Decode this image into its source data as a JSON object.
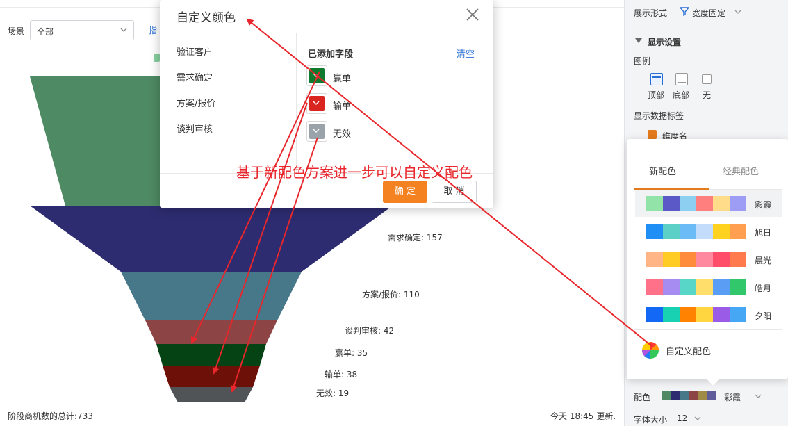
{
  "main": {
    "scene_label": "场景",
    "scene_value": "全部",
    "metric_link": "指",
    "footer_total": "阶段商机数的总计:733",
    "footer_time": "今天 18:45 更新."
  },
  "chart_data": {
    "type": "funnel",
    "stages": [
      {
        "name": "验证客户",
        "value": null,
        "color": "#4e8a63",
        "label": ""
      },
      {
        "name": "需求确定",
        "value": 157,
        "color": "#2d2c70",
        "label": "需求确定: 157"
      },
      {
        "name": "方案/报价",
        "value": 110,
        "color": "#47788a",
        "label": "方案/报价: 110"
      },
      {
        "name": "谈判审核",
        "value": 42,
        "color": "#8c4444",
        "label": "谈判审核: 42"
      },
      {
        "name": "赢单",
        "value": 35,
        "color": "#054314",
        "label": "赢单: 35"
      },
      {
        "name": "输单",
        "value": 38,
        "color": "#6d1007",
        "label": "输单: 38"
      },
      {
        "name": "无效",
        "value": 19,
        "color": "#515456",
        "label": "无效: 19"
      }
    ],
    "total": 733
  },
  "panel": {
    "display_form_label": "展示形式",
    "width_mode": "宽度固定",
    "display_settings": "显示设置",
    "legend_label": "图例",
    "legend_options": [
      "顶部",
      "底部",
      "无"
    ],
    "data_label_title": "显示数据标签",
    "dimension_name": "维度名",
    "palette_label": "配色",
    "palette_value": "彩霞",
    "palette_colors": [
      "#4e8a63",
      "#2d2c70",
      "#47788a",
      "#8c4444",
      "#a08b46",
      "#5f5c9a"
    ],
    "font_size_label": "字体大小",
    "font_size_value": "12"
  },
  "popover": {
    "tabs": [
      "新配色",
      "经典配色"
    ],
    "schemes": [
      {
        "name": "彩霞",
        "colors": [
          "#91e3a8",
          "#5a59c7",
          "#8ccff0",
          "#ff7f7f",
          "#ffdc8a",
          "#9d9df5"
        ]
      },
      {
        "name": "旭日",
        "colors": [
          "#1f8ff5",
          "#5ccfc6",
          "#6bbbf7",
          "#c4dcfb",
          "#ffd21f",
          "#ff9f4f"
        ]
      },
      {
        "name": "晨光",
        "colors": [
          "#ffb585",
          "#ffcc26",
          "#ff8c3b",
          "#ff8a9f",
          "#ff4d6a",
          "#ff7a4d"
        ]
      },
      {
        "name": "皓月",
        "colors": [
          "#ff7189",
          "#a68cf0",
          "#58d6c8",
          "#ffde6b",
          "#5a9df5",
          "#33c76b"
        ]
      },
      {
        "name": "夕阳",
        "colors": [
          "#1368f5",
          "#17d1b2",
          "#ff8300",
          "#ffd540",
          "#9a5ce6",
          "#46a8f5"
        ]
      }
    ],
    "custom_label": "自定义配色"
  },
  "dialog": {
    "title": "自定义颜色",
    "stages": [
      "验证客户",
      "需求确定",
      "方案/报价",
      "谈判审核"
    ],
    "added_title": "已添加字段",
    "clear_label": "清空",
    "fields": [
      {
        "name": "赢单",
        "color": "#0f7a2e"
      },
      {
        "name": "输单",
        "color": "#d9241f"
      },
      {
        "name": "无效",
        "color": "#9aa2aa"
      }
    ],
    "ok_label": "确 定",
    "cancel_label": "取 消"
  },
  "annotation": {
    "text": "基于新配色方案进一步可以自定义配色",
    "color": "#e8262b"
  }
}
